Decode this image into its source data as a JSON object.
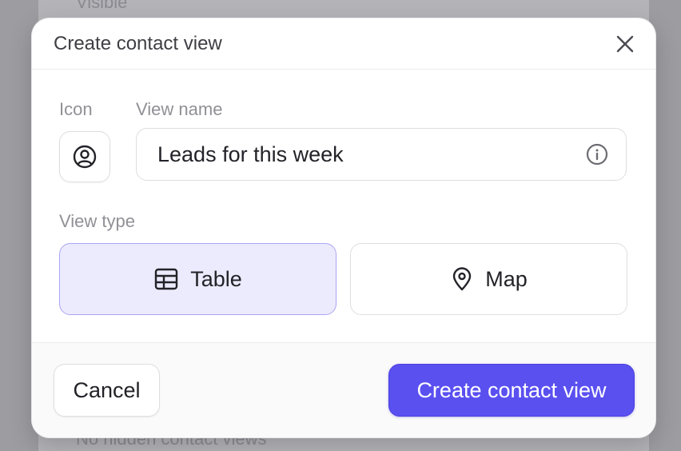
{
  "background": {
    "top_text": "Visible",
    "bottom_text": "No hidden contact views"
  },
  "modal": {
    "title": "Create contact view",
    "close_icon": "close-icon"
  },
  "form": {
    "icon_label": "Icon",
    "selected_icon": "user-circle-icon",
    "view_name_label": "View name",
    "view_name_value": "Leads for this week",
    "view_name_info_icon": "info-icon",
    "view_type_label": "View type",
    "view_types": [
      {
        "label": "Table",
        "icon": "table-icon",
        "selected": true
      },
      {
        "label": "Map",
        "icon": "map-pin-icon",
        "selected": false
      }
    ]
  },
  "footer": {
    "cancel_label": "Cancel",
    "create_label": "Create contact view"
  },
  "colors": {
    "accent": "#5a50f0",
    "selected_bg": "#ecebfd",
    "selected_border": "#aaa5f3"
  }
}
